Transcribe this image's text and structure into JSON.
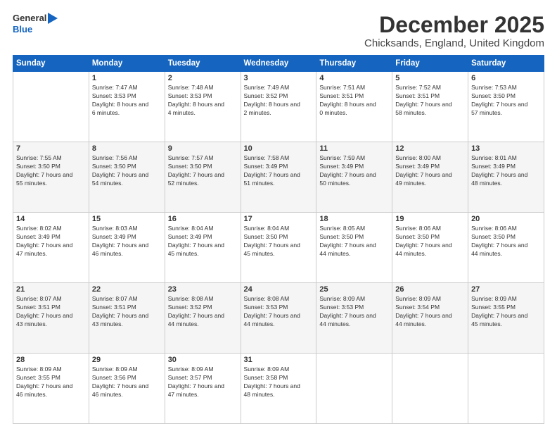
{
  "header": {
    "logo": {
      "line1": "General",
      "line2": "Blue"
    },
    "title": "December 2025",
    "subtitle": "Chicksands, England, United Kingdom"
  },
  "weekdays": [
    "Sunday",
    "Monday",
    "Tuesday",
    "Wednesday",
    "Thursday",
    "Friday",
    "Saturday"
  ],
  "weeks": [
    [
      {
        "day": "",
        "sunrise": "",
        "sunset": "",
        "daylight": ""
      },
      {
        "day": "1",
        "sunrise": "Sunrise: 7:47 AM",
        "sunset": "Sunset: 3:53 PM",
        "daylight": "Daylight: 8 hours and 6 minutes."
      },
      {
        "day": "2",
        "sunrise": "Sunrise: 7:48 AM",
        "sunset": "Sunset: 3:53 PM",
        "daylight": "Daylight: 8 hours and 4 minutes."
      },
      {
        "day": "3",
        "sunrise": "Sunrise: 7:49 AM",
        "sunset": "Sunset: 3:52 PM",
        "daylight": "Daylight: 8 hours and 2 minutes."
      },
      {
        "day": "4",
        "sunrise": "Sunrise: 7:51 AM",
        "sunset": "Sunset: 3:51 PM",
        "daylight": "Daylight: 8 hours and 0 minutes."
      },
      {
        "day": "5",
        "sunrise": "Sunrise: 7:52 AM",
        "sunset": "Sunset: 3:51 PM",
        "daylight": "Daylight: 7 hours and 58 minutes."
      },
      {
        "day": "6",
        "sunrise": "Sunrise: 7:53 AM",
        "sunset": "Sunset: 3:50 PM",
        "daylight": "Daylight: 7 hours and 57 minutes."
      }
    ],
    [
      {
        "day": "7",
        "sunrise": "Sunrise: 7:55 AM",
        "sunset": "Sunset: 3:50 PM",
        "daylight": "Daylight: 7 hours and 55 minutes."
      },
      {
        "day": "8",
        "sunrise": "Sunrise: 7:56 AM",
        "sunset": "Sunset: 3:50 PM",
        "daylight": "Daylight: 7 hours and 54 minutes."
      },
      {
        "day": "9",
        "sunrise": "Sunrise: 7:57 AM",
        "sunset": "Sunset: 3:50 PM",
        "daylight": "Daylight: 7 hours and 52 minutes."
      },
      {
        "day": "10",
        "sunrise": "Sunrise: 7:58 AM",
        "sunset": "Sunset: 3:49 PM",
        "daylight": "Daylight: 7 hours and 51 minutes."
      },
      {
        "day": "11",
        "sunrise": "Sunrise: 7:59 AM",
        "sunset": "Sunset: 3:49 PM",
        "daylight": "Daylight: 7 hours and 50 minutes."
      },
      {
        "day": "12",
        "sunrise": "Sunrise: 8:00 AM",
        "sunset": "Sunset: 3:49 PM",
        "daylight": "Daylight: 7 hours and 49 minutes."
      },
      {
        "day": "13",
        "sunrise": "Sunrise: 8:01 AM",
        "sunset": "Sunset: 3:49 PM",
        "daylight": "Daylight: 7 hours and 48 minutes."
      }
    ],
    [
      {
        "day": "14",
        "sunrise": "Sunrise: 8:02 AM",
        "sunset": "Sunset: 3:49 PM",
        "daylight": "Daylight: 7 hours and 47 minutes."
      },
      {
        "day": "15",
        "sunrise": "Sunrise: 8:03 AM",
        "sunset": "Sunset: 3:49 PM",
        "daylight": "Daylight: 7 hours and 46 minutes."
      },
      {
        "day": "16",
        "sunrise": "Sunrise: 8:04 AM",
        "sunset": "Sunset: 3:49 PM",
        "daylight": "Daylight: 7 hours and 45 minutes."
      },
      {
        "day": "17",
        "sunrise": "Sunrise: 8:04 AM",
        "sunset": "Sunset: 3:50 PM",
        "daylight": "Daylight: 7 hours and 45 minutes."
      },
      {
        "day": "18",
        "sunrise": "Sunrise: 8:05 AM",
        "sunset": "Sunset: 3:50 PM",
        "daylight": "Daylight: 7 hours and 44 minutes."
      },
      {
        "day": "19",
        "sunrise": "Sunrise: 8:06 AM",
        "sunset": "Sunset: 3:50 PM",
        "daylight": "Daylight: 7 hours and 44 minutes."
      },
      {
        "day": "20",
        "sunrise": "Sunrise: 8:06 AM",
        "sunset": "Sunset: 3:50 PM",
        "daylight": "Daylight: 7 hours and 44 minutes."
      }
    ],
    [
      {
        "day": "21",
        "sunrise": "Sunrise: 8:07 AM",
        "sunset": "Sunset: 3:51 PM",
        "daylight": "Daylight: 7 hours and 43 minutes."
      },
      {
        "day": "22",
        "sunrise": "Sunrise: 8:07 AM",
        "sunset": "Sunset: 3:51 PM",
        "daylight": "Daylight: 7 hours and 43 minutes."
      },
      {
        "day": "23",
        "sunrise": "Sunrise: 8:08 AM",
        "sunset": "Sunset: 3:52 PM",
        "daylight": "Daylight: 7 hours and 44 minutes."
      },
      {
        "day": "24",
        "sunrise": "Sunrise: 8:08 AM",
        "sunset": "Sunset: 3:53 PM",
        "daylight": "Daylight: 7 hours and 44 minutes."
      },
      {
        "day": "25",
        "sunrise": "Sunrise: 8:09 AM",
        "sunset": "Sunset: 3:53 PM",
        "daylight": "Daylight: 7 hours and 44 minutes."
      },
      {
        "day": "26",
        "sunrise": "Sunrise: 8:09 AM",
        "sunset": "Sunset: 3:54 PM",
        "daylight": "Daylight: 7 hours and 44 minutes."
      },
      {
        "day": "27",
        "sunrise": "Sunrise: 8:09 AM",
        "sunset": "Sunset: 3:55 PM",
        "daylight": "Daylight: 7 hours and 45 minutes."
      }
    ],
    [
      {
        "day": "28",
        "sunrise": "Sunrise: 8:09 AM",
        "sunset": "Sunset: 3:55 PM",
        "daylight": "Daylight: 7 hours and 46 minutes."
      },
      {
        "day": "29",
        "sunrise": "Sunrise: 8:09 AM",
        "sunset": "Sunset: 3:56 PM",
        "daylight": "Daylight: 7 hours and 46 minutes."
      },
      {
        "day": "30",
        "sunrise": "Sunrise: 8:09 AM",
        "sunset": "Sunset: 3:57 PM",
        "daylight": "Daylight: 7 hours and 47 minutes."
      },
      {
        "day": "31",
        "sunrise": "Sunrise: 8:09 AM",
        "sunset": "Sunset: 3:58 PM",
        "daylight": "Daylight: 7 hours and 48 minutes."
      },
      {
        "day": "",
        "sunrise": "",
        "sunset": "",
        "daylight": ""
      },
      {
        "day": "",
        "sunrise": "",
        "sunset": "",
        "daylight": ""
      },
      {
        "day": "",
        "sunrise": "",
        "sunset": "",
        "daylight": ""
      }
    ]
  ]
}
